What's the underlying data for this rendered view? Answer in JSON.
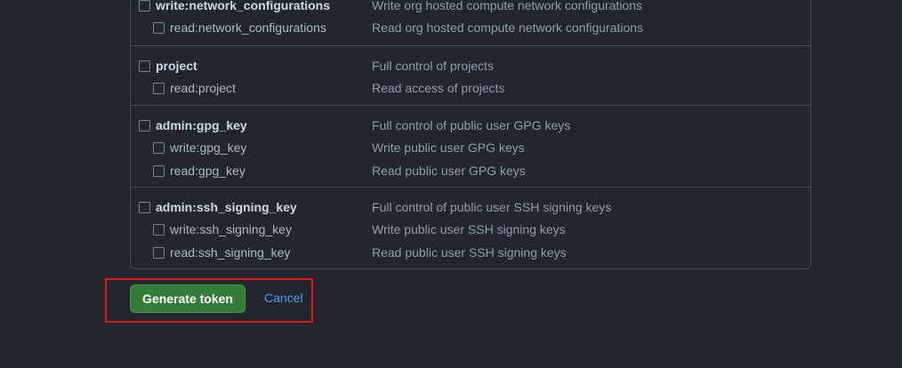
{
  "scope_groups": [
    {
      "parent": {
        "name": "write:network_configurations",
        "description": "Write org hosted compute network configurations",
        "checked": false
      },
      "children": [
        {
          "name": "read:network_configurations",
          "description": "Read org hosted compute network configurations",
          "checked": false
        }
      ]
    },
    {
      "parent": {
        "name": "project",
        "description": "Full control of projects",
        "checked": false
      },
      "children": [
        {
          "name": "read:project",
          "description": "Read access of projects",
          "checked": false
        }
      ]
    },
    {
      "parent": {
        "name": "admin:gpg_key",
        "description": "Full control of public user GPG keys",
        "checked": false
      },
      "children": [
        {
          "name": "write:gpg_key",
          "description": "Write public user GPG keys",
          "checked": false
        },
        {
          "name": "read:gpg_key",
          "description": "Read public user GPG keys",
          "checked": false
        }
      ]
    },
    {
      "parent": {
        "name": "admin:ssh_signing_key",
        "description": "Full control of public user SSH signing keys",
        "checked": false
      },
      "children": [
        {
          "name": "write:ssh_signing_key",
          "description": "Write public user SSH signing keys",
          "checked": false
        },
        {
          "name": "read:ssh_signing_key",
          "description": "Read public user SSH signing keys",
          "checked": false
        }
      ]
    }
  ],
  "actions": {
    "generate_label": "Generate token",
    "cancel_label": "Cancel"
  },
  "colors": {
    "background": "#22272e",
    "primary_button": "#347d39",
    "link": "#539bf5",
    "highlight_border": "#e5141b"
  }
}
